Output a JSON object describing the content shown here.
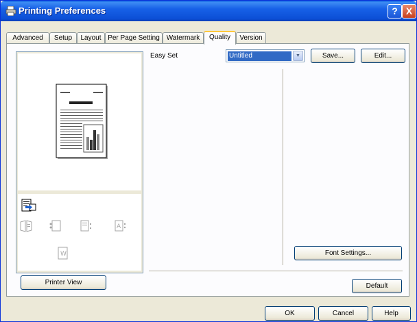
{
  "window": {
    "title": "Printing Preferences",
    "help_label": "?",
    "close_label": "X"
  },
  "tabs": [
    {
      "label": "Advanced"
    },
    {
      "label": "Setup"
    },
    {
      "label": "Layout"
    },
    {
      "label": "Per Page Setting"
    },
    {
      "label": "Watermark"
    },
    {
      "label": "Quality",
      "active": true
    },
    {
      "label": "Version"
    }
  ],
  "quality": {
    "easy_set_label": "Easy Set",
    "easy_set_value": "Untitled",
    "save_label": "Save...",
    "edit_label": "Edit...",
    "font_settings_label": "Font Settings...",
    "default_label": "Default",
    "printer_view_label": "Printer View"
  },
  "footer": {
    "ok_label": "OK",
    "cancel_label": "Cancel",
    "help_label": "Help"
  },
  "colors": {
    "titlebar": "#1761e7",
    "selection": "#316ac5",
    "tab_highlight": "#ffc83c",
    "dialog_bg": "#ece9d8"
  }
}
